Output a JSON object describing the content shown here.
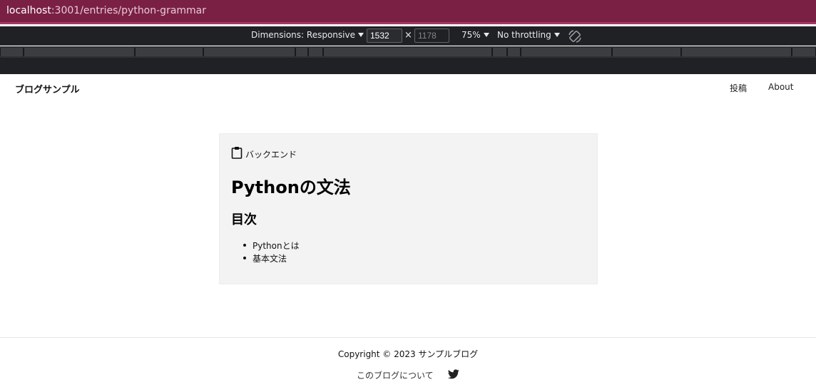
{
  "browser": {
    "url_host": "localhost",
    "url_rest": ":3001/entries/python-grammar"
  },
  "devtools": {
    "dimensions_label": "Dimensions: Responsive",
    "width_value": "1532",
    "height_placeholder": "1178",
    "times": "×",
    "zoom": "75%",
    "throttling": "No throttling",
    "rotate_icon": "rotate-icon"
  },
  "header": {
    "brand": "ブログサンプル",
    "nav": [
      "投稿",
      "About"
    ]
  },
  "article": {
    "category_icon": "clipboard-icon",
    "category": "バックエンド",
    "title": "Pythonの文法",
    "toc_heading": "目次",
    "toc_items": [
      "Pythonとは",
      "基本文法"
    ]
  },
  "footer": {
    "copyright": "Copyright © 2023 サンプルブログ",
    "about_link": "このブログについて",
    "social_icon": "twitter-icon"
  },
  "colors": {
    "url_bar": "#7a2044",
    "devtools_bg": "#202124",
    "card_bg": "#f3f3f3"
  }
}
